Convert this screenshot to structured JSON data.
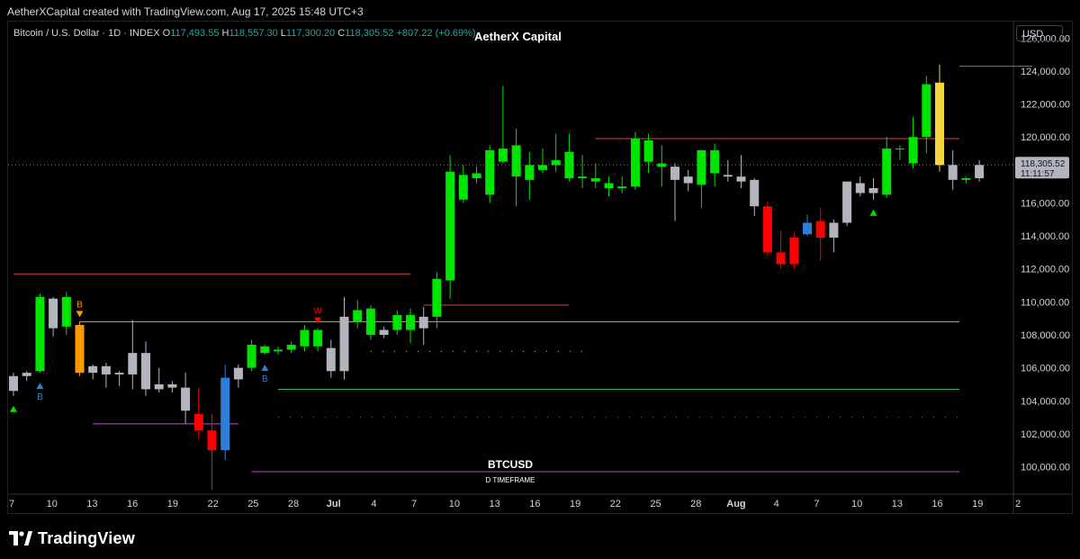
{
  "caption": "AetherXCapital created with TradingView.com, Aug 17, 2025 15:48 UTC+3",
  "header": {
    "symbol": "Bitcoin / U.S. Dollar · 1D · INDEX",
    "o_label": "O",
    "o_value": "117,493.55",
    "h_label": "H",
    "h_value": "118,557.30",
    "l_label": "L",
    "l_value": "117,300.20",
    "c_label": "C",
    "c_value": "118,305.52",
    "change": "+807.22 (+0.69%)"
  },
  "watermark_title": "AetherX Capital",
  "currency": "USD",
  "footer": {
    "logo_text": "TradingView"
  },
  "colors": {
    "bull_green": "#00e500",
    "bear_red": "#ff0000",
    "neutral": "#b2b5be",
    "orange": "#ff9800",
    "yellow": "#f5d442",
    "blue": "#2e7dd7",
    "axis_text": "#d1d4dc",
    "background": "#000000"
  },
  "chart_data": {
    "type": "candlestick",
    "symbol_label": "BTCUSD",
    "timeframe_label": "D TIMEFRAME",
    "ylim": [
      98500,
      127000
    ],
    "y_ticks": [
      "126,000.00",
      "124,000.00",
      "122,000.00",
      "120,000.00",
      "118,000.00",
      "116,000.00",
      "114,000.00",
      "112,000.00",
      "110,000.00",
      "108,000.00",
      "106,000.00",
      "104,000.00",
      "102,000.00",
      "100,000.00"
    ],
    "y_tick_values": [
      126000,
      124000,
      122000,
      120000,
      118000,
      116000,
      114000,
      112000,
      110000,
      108000,
      106000,
      104000,
      102000,
      100000
    ],
    "x_ticks": [
      "7",
      "10",
      "13",
      "16",
      "19",
      "22",
      "25",
      "28",
      "Jul",
      "4",
      "7",
      "10",
      "13",
      "16",
      "19",
      "22",
      "25",
      "28",
      "Aug",
      "4",
      "7",
      "10",
      "13",
      "16",
      "19",
      "2"
    ],
    "last_price": {
      "price_label": "118,305.52",
      "countdown_label": "11:11:57",
      "value": 118305.52
    },
    "candles": [
      {
        "o": 104600,
        "h": 105700,
        "l": 104300,
        "c": 105500,
        "col": "neutral"
      },
      {
        "o": 105500,
        "h": 105800,
        "l": 105200,
        "c": 105700,
        "col": "neutral"
      },
      {
        "o": 105800,
        "h": 110500,
        "l": 105700,
        "c": 110300,
        "col": "bull_green"
      },
      {
        "o": 110200,
        "h": 110300,
        "l": 107900,
        "c": 108400,
        "col": "neutral"
      },
      {
        "o": 108500,
        "h": 110600,
        "l": 108000,
        "c": 110300,
        "col": "bull_green"
      },
      {
        "o": 108600,
        "h": 108800,
        "l": 105500,
        "c": 105700,
        "col": "orange"
      },
      {
        "o": 105700,
        "h": 106200,
        "l": 105300,
        "c": 106100,
        "col": "neutral"
      },
      {
        "o": 106100,
        "h": 106300,
        "l": 104800,
        "c": 105600,
        "col": "neutral"
      },
      {
        "o": 105600,
        "h": 105800,
        "l": 104900,
        "c": 105700,
        "col": "neutral"
      },
      {
        "o": 105600,
        "h": 108900,
        "l": 104700,
        "c": 106900,
        "col": "neutral"
      },
      {
        "o": 106900,
        "h": 107600,
        "l": 104300,
        "c": 104700,
        "col": "neutral"
      },
      {
        "o": 104700,
        "h": 106000,
        "l": 104500,
        "c": 105000,
        "col": "neutral"
      },
      {
        "o": 104800,
        "h": 105200,
        "l": 104500,
        "c": 105000,
        "col": "neutral"
      },
      {
        "o": 104800,
        "h": 105700,
        "l": 102600,
        "c": 103400,
        "col": "neutral"
      },
      {
        "o": 103200,
        "h": 104800,
        "l": 101700,
        "c": 102200,
        "col": "bear_red"
      },
      {
        "o": 102200,
        "h": 103200,
        "l": 98600,
        "c": 101000,
        "col": "bear_red"
      },
      {
        "o": 101000,
        "h": 106200,
        "l": 100400,
        "c": 105400,
        "col": "blue"
      },
      {
        "o": 105300,
        "h": 106200,
        "l": 104800,
        "c": 106000,
        "col": "neutral"
      },
      {
        "o": 106000,
        "h": 107700,
        "l": 105800,
        "c": 107400,
        "col": "bull_green"
      },
      {
        "o": 106900,
        "h": 107400,
        "l": 106800,
        "c": 107300,
        "col": "bull_green"
      },
      {
        "o": 107000,
        "h": 107300,
        "l": 106800,
        "c": 107100,
        "col": "bull_green"
      },
      {
        "o": 107100,
        "h": 107600,
        "l": 106900,
        "c": 107400,
        "col": "bull_green"
      },
      {
        "o": 107300,
        "h": 108600,
        "l": 107000,
        "c": 108300,
        "col": "bull_green"
      },
      {
        "o": 107300,
        "h": 108400,
        "l": 107000,
        "c": 108300,
        "col": "bull_green"
      },
      {
        "o": 107200,
        "h": 107700,
        "l": 105400,
        "c": 105800,
        "col": "neutral"
      },
      {
        "o": 105800,
        "h": 110300,
        "l": 105300,
        "c": 109100,
        "col": "neutral"
      },
      {
        "o": 108800,
        "h": 110100,
        "l": 108400,
        "c": 109500,
        "col": "bull_green"
      },
      {
        "o": 109600,
        "h": 109800,
        "l": 107700,
        "c": 108000,
        "col": "bull_green"
      },
      {
        "o": 108000,
        "h": 108500,
        "l": 107800,
        "c": 108300,
        "col": "neutral"
      },
      {
        "o": 108300,
        "h": 109500,
        "l": 108000,
        "c": 109200,
        "col": "bull_green"
      },
      {
        "o": 108300,
        "h": 109600,
        "l": 107500,
        "c": 109200,
        "col": "bull_green"
      },
      {
        "o": 108400,
        "h": 109700,
        "l": 107400,
        "c": 109100,
        "col": "neutral"
      },
      {
        "o": 109100,
        "h": 111800,
        "l": 108400,
        "c": 111400,
        "col": "bull_green"
      },
      {
        "o": 111300,
        "h": 118900,
        "l": 110200,
        "c": 117900,
        "col": "bull_green"
      },
      {
        "o": 116200,
        "h": 118300,
        "l": 116000,
        "c": 117700,
        "col": "bull_green"
      },
      {
        "o": 117500,
        "h": 118200,
        "l": 117200,
        "c": 117800,
        "col": "bull_green"
      },
      {
        "o": 116500,
        "h": 119500,
        "l": 116000,
        "c": 119200,
        "col": "bull_green"
      },
      {
        "o": 118500,
        "h": 123100,
        "l": 118400,
        "c": 119300,
        "col": "bull_green"
      },
      {
        "o": 119500,
        "h": 120500,
        "l": 115800,
        "c": 117600,
        "col": "bull_green"
      },
      {
        "o": 117400,
        "h": 119100,
        "l": 116200,
        "c": 118300,
        "col": "bull_green"
      },
      {
        "o": 118000,
        "h": 119300,
        "l": 117800,
        "c": 118300,
        "col": "bull_green"
      },
      {
        "o": 118300,
        "h": 120200,
        "l": 117900,
        "c": 118600,
        "col": "bull_green"
      },
      {
        "o": 117500,
        "h": 120200,
        "l": 117300,
        "c": 119100,
        "col": "bull_green"
      },
      {
        "o": 117600,
        "h": 118900,
        "l": 116900,
        "c": 117500,
        "col": "bull_green"
      },
      {
        "o": 117500,
        "h": 118400,
        "l": 116900,
        "c": 117300,
        "col": "bull_green"
      },
      {
        "o": 116900,
        "h": 117600,
        "l": 116400,
        "c": 117200,
        "col": "bull_green"
      },
      {
        "o": 116900,
        "h": 117600,
        "l": 116600,
        "c": 117000,
        "col": "bull_green"
      },
      {
        "o": 117000,
        "h": 120300,
        "l": 116800,
        "c": 119900,
        "col": "bull_green"
      },
      {
        "o": 118500,
        "h": 120200,
        "l": 117800,
        "c": 119800,
        "col": "bull_green"
      },
      {
        "o": 118400,
        "h": 119500,
        "l": 117000,
        "c": 118200,
        "col": "bull_green"
      },
      {
        "o": 118200,
        "h": 118400,
        "l": 114900,
        "c": 117400,
        "col": "neutral"
      },
      {
        "o": 117200,
        "h": 118000,
        "l": 116700,
        "c": 117600,
        "col": "neutral"
      },
      {
        "o": 117100,
        "h": 119000,
        "l": 115700,
        "c": 119200,
        "col": "bull_green"
      },
      {
        "o": 117800,
        "h": 119600,
        "l": 117000,
        "c": 119200,
        "col": "bull_green"
      },
      {
        "o": 117700,
        "h": 118600,
        "l": 117300,
        "c": 117600,
        "col": "neutral"
      },
      {
        "o": 117600,
        "h": 118900,
        "l": 116900,
        "c": 117300,
        "col": "neutral"
      },
      {
        "o": 117400,
        "h": 117500,
        "l": 115200,
        "c": 115800,
        "col": "neutral"
      },
      {
        "o": 115800,
        "h": 116100,
        "l": 112800,
        "c": 113000,
        "col": "bear_red"
      },
      {
        "o": 113000,
        "h": 114300,
        "l": 112000,
        "c": 112300,
        "col": "bear_red"
      },
      {
        "o": 112300,
        "h": 114200,
        "l": 112000,
        "c": 113900,
        "col": "bear_red"
      },
      {
        "o": 114100,
        "h": 115300,
        "l": 114000,
        "c": 114800,
        "col": "blue"
      },
      {
        "o": 114900,
        "h": 115700,
        "l": 112500,
        "c": 113900,
        "col": "bear_red"
      },
      {
        "o": 113900,
        "h": 115000,
        "l": 113000,
        "c": 114800,
        "col": "neutral"
      },
      {
        "o": 114800,
        "h": 117200,
        "l": 114600,
        "c": 117300,
        "col": "neutral"
      },
      {
        "o": 117200,
        "h": 117600,
        "l": 116400,
        "c": 116600,
        "col": "neutral"
      },
      {
        "o": 116600,
        "h": 117500,
        "l": 116200,
        "c": 116900,
        "col": "neutral"
      },
      {
        "o": 116500,
        "h": 120000,
        "l": 116300,
        "c": 119300,
        "col": "bull_green"
      },
      {
        "o": 119300,
        "h": 119500,
        "l": 118600,
        "c": 119300,
        "col": "bull_green"
      },
      {
        "o": 118400,
        "h": 121200,
        "l": 118100,
        "c": 120000,
        "col": "bull_green"
      },
      {
        "o": 120000,
        "h": 123700,
        "l": 119000,
        "c": 123200,
        "col": "bull_green"
      },
      {
        "o": 123300,
        "h": 124400,
        "l": 117900,
        "c": 118300,
        "col": "yellow"
      },
      {
        "o": 118300,
        "h": 119200,
        "l": 116800,
        "c": 117400,
        "col": "neutral"
      },
      {
        "o": 117400,
        "h": 117600,
        "l": 117200,
        "c": 117500,
        "col": "bull_green"
      },
      {
        "o": 117500,
        "h": 118600,
        "l": 117300,
        "c": 118300,
        "col": "neutral"
      }
    ],
    "levels": [
      {
        "price": 111700,
        "from": 0,
        "to": 30,
        "color": "#e04040",
        "style": "solid"
      },
      {
        "price": 108800,
        "from": 5,
        "to": 82,
        "color": "#9acd32",
        "style": "solid"
      },
      {
        "price": 109800,
        "from": 31,
        "to": 42,
        "color": "#e04040",
        "style": "solid"
      },
      {
        "price": 104700,
        "from": 20,
        "to": 82,
        "color": "#3cb371",
        "style": "solid"
      },
      {
        "price": 103000,
        "from": 20,
        "to": 82,
        "color": "#2e7dd7",
        "style": "dotted"
      },
      {
        "price": 99700,
        "from": 18,
        "to": 82,
        "color": "#c04fd0",
        "style": "solid"
      },
      {
        "price": 119900,
        "from": 44,
        "to": 76,
        "color": "#e04040",
        "style": "solid"
      },
      {
        "price": 124300,
        "from": 77,
        "to": 81,
        "color": "#e04040",
        "style": "solid"
      },
      {
        "price": 102600,
        "from": 6,
        "to": 17,
        "color": "#c04fd0",
        "style": "solid"
      },
      {
        "price": 107000,
        "from": 27,
        "to": 43,
        "color": "#ffd700",
        "style": "dotted"
      }
    ],
    "markers": [
      {
        "i": 0,
        "dir": "up",
        "color": "#00e500",
        "text": ""
      },
      {
        "i": 2,
        "dir": "up",
        "color": "#2e7dd7",
        "text": "B"
      },
      {
        "i": 5,
        "dir": "down",
        "color": "#ff9800",
        "text": "B"
      },
      {
        "i": 19,
        "dir": "up",
        "color": "#2e7dd7",
        "text": "B"
      },
      {
        "i": 23,
        "dir": "down",
        "color": "#ff0000",
        "text": "W"
      },
      {
        "i": 65,
        "dir": "up",
        "color": "#00e500",
        "text": ""
      }
    ]
  }
}
